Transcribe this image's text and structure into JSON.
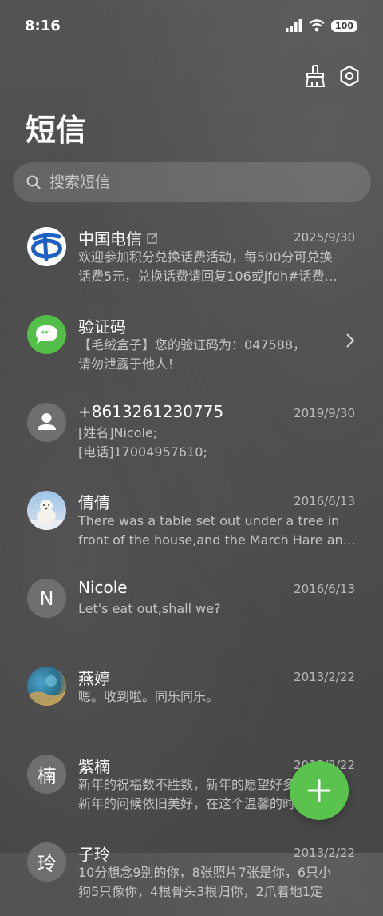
{
  "status_bar": {
    "time": "8:16",
    "battery": "100"
  },
  "header": {
    "title": "短信"
  },
  "search": {
    "placeholder": "搜索短信"
  },
  "messages": [
    {
      "sender": "中国电信",
      "date": "2025/9/30",
      "line1": "欢迎参加积分兑换话费活动，每500分可兑换",
      "line2": "话费5元，兑换话费请回复106或jfdh#话费…",
      "avatar": "telecom-logo"
    },
    {
      "sender": "验证码",
      "date": "",
      "line1": "【毛绒盒子】您的验证码为：047588，",
      "line2": "请勿泄露于他人！",
      "avatar": "sms-code"
    },
    {
      "sender": "+8613261230775",
      "date": "2019/9/30",
      "line1": "[姓名]Nicole;",
      "line2": "[电话]17004957610;",
      "avatar": "person"
    },
    {
      "sender": "倩倩",
      "date": "2016/6/13",
      "line1": "There was a table set out under a tree in",
      "line2": "front of the house,and the March Hare an…",
      "avatar": "polar-bear"
    },
    {
      "sender": "Nicole",
      "date": "2016/6/13",
      "line1": "Let's eat out,shall we?",
      "line2": "",
      "avatar_letter": "N"
    },
    {
      "sender": "燕婷",
      "date": "2013/2/22",
      "line1": "嗯。收到啦。同乐同乐。",
      "line2": "",
      "avatar": "photo"
    },
    {
      "sender": "紫楠",
      "date": "2013/2/22",
      "line1": "新年的祝福数不胜数，新年的愿望好多好多，",
      "line2": "新年的问候依旧美好，在这个温馨的时刻…",
      "avatar_letter": "楠"
    },
    {
      "sender": "子玲",
      "date": "2013/2/22",
      "line1": "10分想念9别的你，8张照片7张是你，6只小",
      "line2": "狗5只像你，4根骨头3根归你，2爪着地1定",
      "avatar_letter": "玲"
    }
  ]
}
